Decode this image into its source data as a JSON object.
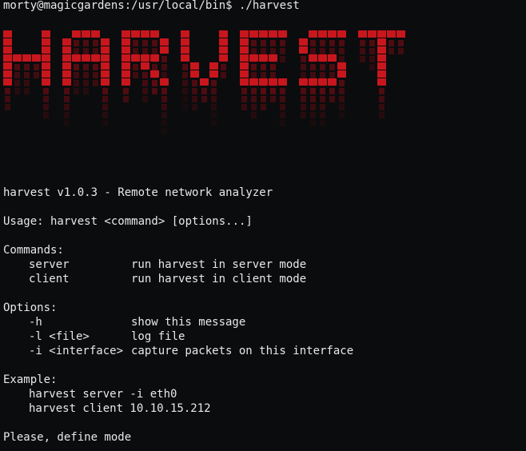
{
  "terminal": {
    "prompt": "morty@magicgardens:/usr/local/bin$ ./harvest",
    "banner_text": "HARVEST",
    "version_line": "harvest v1.0.3 - Remote network analyzer",
    "usage_line": "Usage: harvest <command> [options...]",
    "commands_header": "Commands:",
    "commands": [
      {
        "name": "server",
        "desc": "run harvest in server mode"
      },
      {
        "name": "client",
        "desc": "run harvest in client mode"
      }
    ],
    "options_header": "Options:",
    "options": [
      {
        "flag": "-h",
        "desc": "show this message"
      },
      {
        "flag": "-l <file>",
        "desc": "log file"
      },
      {
        "flag": "-i <interface>",
        "desc": "capture packets on this interface"
      }
    ],
    "example_header": "Example:",
    "examples": [
      "harvest server -i eth0",
      "harvest client 10.10.15.212"
    ],
    "final_line": "Please, define mode"
  },
  "colors": {
    "background": "#0b0c0e",
    "text": "#e8e8e8",
    "banner_red": "#c8161d",
    "banner_red_dark": "#6a0d12"
  }
}
